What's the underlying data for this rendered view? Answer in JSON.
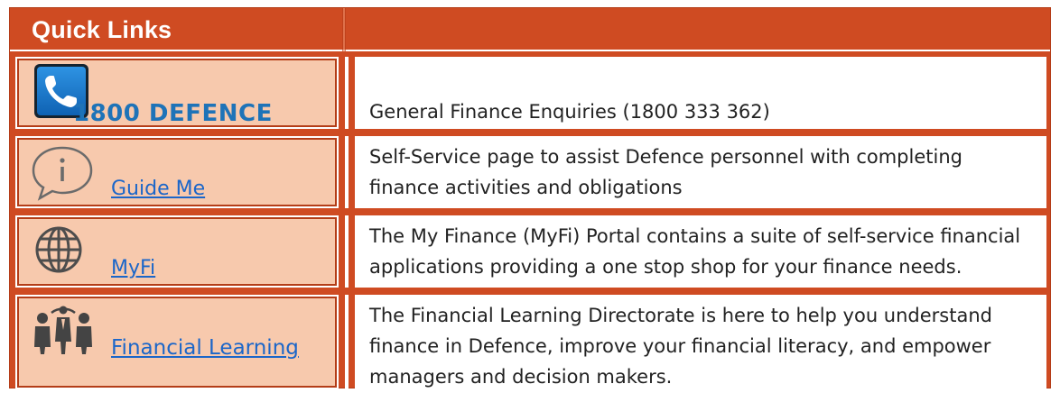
{
  "header": {
    "title": "Quick Links"
  },
  "rows": [
    {
      "label": "1800 DEFENCE",
      "icon": "phone-icon",
      "description": "General Finance Enquiries (1800 333 362)"
    },
    {
      "label": "Guide Me",
      "icon": "info-speech-bubble-icon",
      "description": "Self-Service page to assist Defence personnel with completing finance activities and obligations"
    },
    {
      "label": "MyFi",
      "icon": "globe-icon",
      "description": "The My Finance (MyFi) Portal contains a suite of self-service financial applications providing a one stop shop for your finance needs."
    },
    {
      "label": "Financial Learning",
      "icon": "people-group-icon",
      "description": "The Financial Learning Directorate is here to help you understand finance in Defence, improve your financial literacy, and empower managers and decision makers."
    }
  ],
  "colors": {
    "header": "#cf4b22",
    "left_cell": "#f7c9ad",
    "link": "#1b66c9",
    "phone_label": "#1e73b8"
  }
}
